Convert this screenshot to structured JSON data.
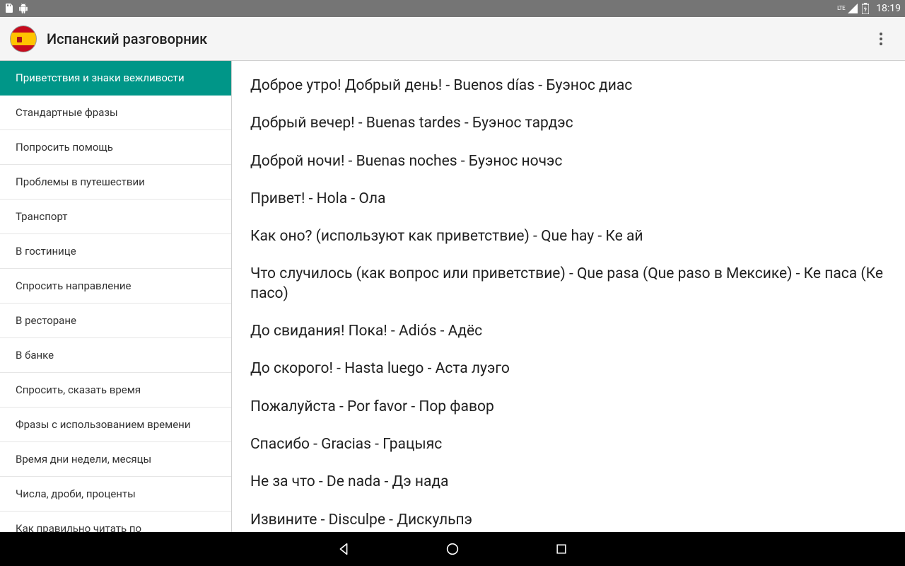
{
  "status": {
    "clock": "18:19",
    "lte": "LTE"
  },
  "app": {
    "title": "Испанский разговорник"
  },
  "sidebar": {
    "active_index": 0,
    "items": [
      {
        "label": "Приветствия и знаки вежливости"
      },
      {
        "label": "Стандартные фразы"
      },
      {
        "label": "Попросить помощь"
      },
      {
        "label": "Проблемы в путешествии"
      },
      {
        "label": "Транспорт"
      },
      {
        "label": "В гостинице"
      },
      {
        "label": "Спросить направление"
      },
      {
        "label": "В ресторане"
      },
      {
        "label": "В банке"
      },
      {
        "label": "Спросить, сказать время"
      },
      {
        "label": "Фразы с использованием времени"
      },
      {
        "label": "Время дни недели, месяцы"
      },
      {
        "label": "Числа, дроби, проценты"
      },
      {
        "label": "Как правильно читать по"
      }
    ]
  },
  "phrases": [
    "Доброе утро! Добрый день! - Buenos días - Буэнос диас",
    "Добрый вечер! - Buenas tardes - Буэнос тардэс",
    "Доброй ночи! - Buenas noches - Буэнос ночэс",
    "Привет! - Hola - Ола",
    "Как оно? (используют как приветствие) - Que hay - Ке ай",
    "Что случилось (как вопрос или приветствие) - Que pasa (Que paso в Мексике) - Ке паса (Ке пасо)",
    "До свидания! Пока! - Adiós - Адёс",
    "До скорого! - Hasta luego - Аста луэго",
    "Пожалуйста - Por favor - Пор фавор",
    "Спасибо - Gracias - Грацыяс",
    "Не за что - De nada - Дэ нада",
    "Извините - Disculpe - Дискульпэ"
  ]
}
